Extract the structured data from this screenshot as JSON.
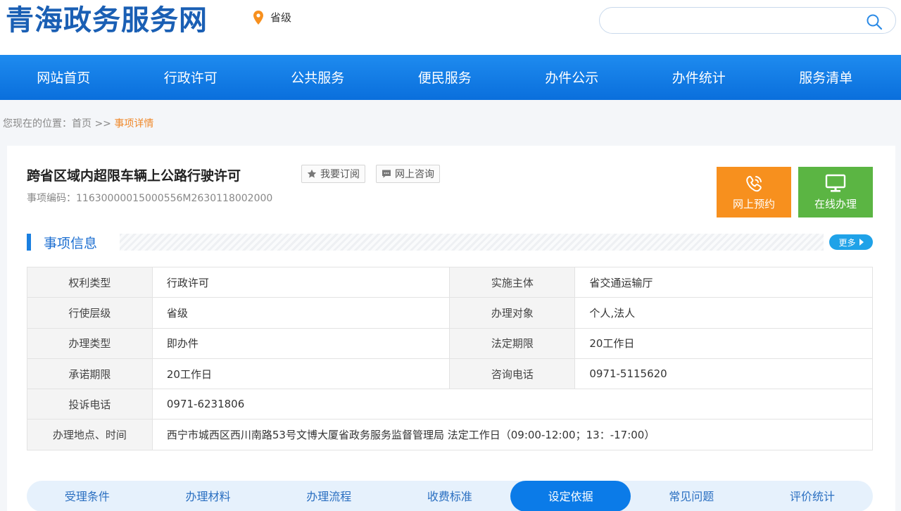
{
  "header": {
    "logo": "青海政务服务网",
    "region": "省级",
    "search_placeholder": ""
  },
  "nav": [
    "网站首页",
    "行政许可",
    "公共服务",
    "便民服务",
    "办件公示",
    "办件统计",
    "服务清单"
  ],
  "breadcrumb": {
    "prefix": "您现在的位置：",
    "home": "首页",
    "sep": " >> ",
    "current": "事项详情"
  },
  "item": {
    "title": "跨省区域内超限车辆上公路行驶许可",
    "code": "事项编码：11630000015000556M2630118002000",
    "subscribe": "我要订阅",
    "consult": "网上咨询",
    "appointment": "网上预约",
    "online": "在线办理"
  },
  "section": {
    "title": "事项信息",
    "more": "更多"
  },
  "info": {
    "r1": {
      "l1": "权利类型",
      "v1": "行政许可",
      "l2": "实施主体",
      "v2": "省交通运输厅"
    },
    "r2": {
      "l1": "行使层级",
      "v1": "省级",
      "l2": "办理对象",
      "v2": "个人,法人"
    },
    "r3": {
      "l1": "办理类型",
      "v1": "即办件",
      "l2": "法定期限",
      "v2": "20工作日"
    },
    "r4": {
      "l1": "承诺期限",
      "v1": "20工作日",
      "l2": "咨询电话",
      "v2": "0971-5115620"
    },
    "r5": {
      "l1": "投诉电话",
      "v1": "0971-6231806"
    },
    "r6": {
      "l1": "办理地点、时间",
      "v1": "西宁市城西区西川南路53号文博大厦省政务服务监督管理局 法定工作日（09:00-12:00；13：-17:00）"
    }
  },
  "tabs": [
    "受理条件",
    "办理材料",
    "办理流程",
    "收费标准",
    "设定依据",
    "常见问题",
    "评价统计"
  ],
  "colors": {
    "brand": "#1a5fb4",
    "nav": "#0a6fdc",
    "orange": "#f7901e",
    "green": "#5bb543",
    "accent": "#f0892b"
  }
}
